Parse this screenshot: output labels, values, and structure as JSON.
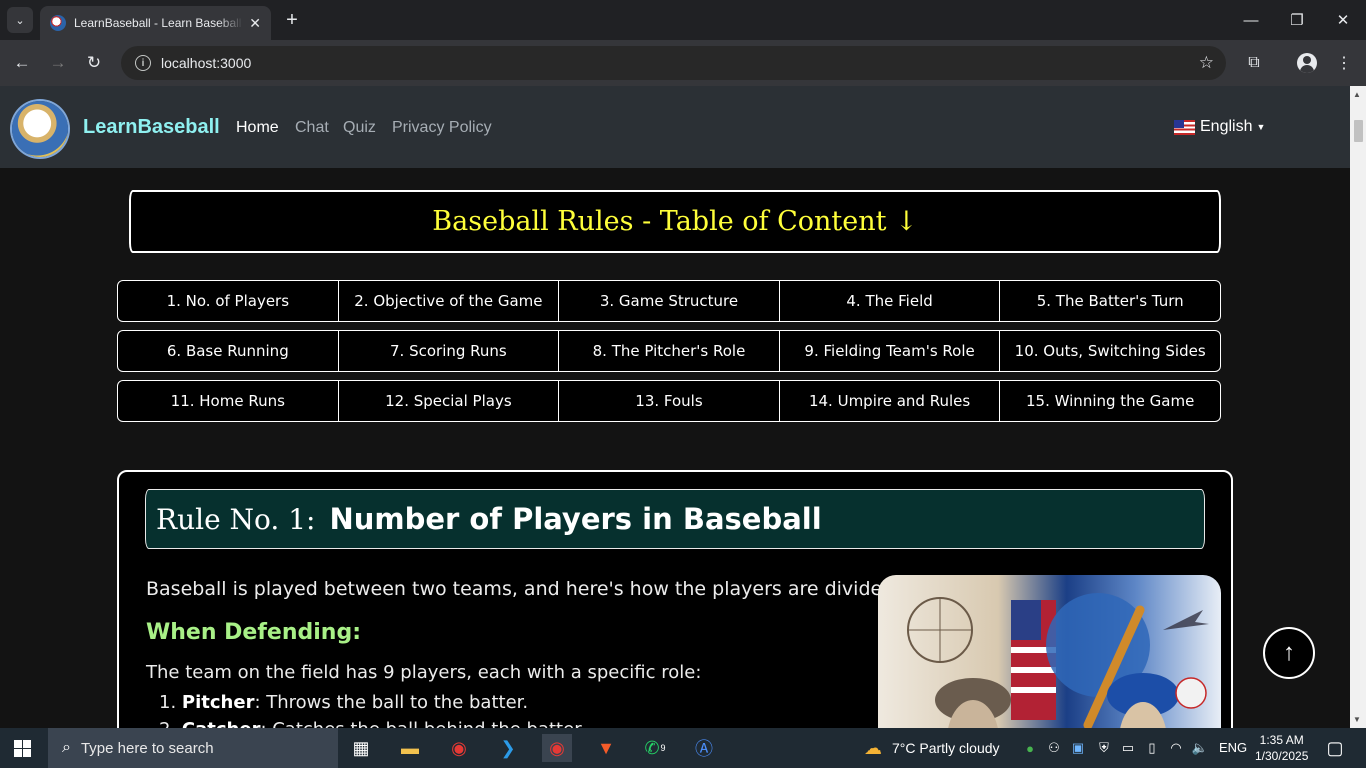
{
  "browser": {
    "tab_title": "LearnBaseball - Learn Baseball Rules",
    "url": "localhost:3000"
  },
  "nav": {
    "brand": "LearnBaseball",
    "links": [
      "Home",
      "Chat",
      "Quiz",
      "Privacy Policy"
    ],
    "language": "English"
  },
  "toc": {
    "title": "Baseball Rules - Table of Content ↓",
    "rows": [
      [
        "1. No. of Players",
        "2. Objective of the Game",
        "3. Game Structure",
        "4. The Field",
        "5. The Batter's Turn"
      ],
      [
        "6. Base Running",
        "7. Scoring Runs",
        "8. The Pitcher's Role",
        "9. Fielding Team's Role",
        "10. Outs, Switching Sides"
      ],
      [
        "11. Home Runs",
        "12. Special Plays",
        "13. Fouls",
        "14. Umpire and Rules",
        "15. Winning the Game"
      ]
    ]
  },
  "rule": {
    "number_label": "Rule No. 1:",
    "title": "Number of Players in Baseball",
    "intro": "Baseball is played between two teams, and here's how the players are divided:",
    "subheading": "When Defending:",
    "team_text": "The team on the field has 9 players, each with a specific role:",
    "roles": [
      {
        "n": "1.",
        "name": "Pitcher",
        "desc": ": Throws the ball to the batter."
      },
      {
        "n": "2.",
        "name": "Catcher",
        "desc": ": Catches the ball behind the batter."
      }
    ]
  },
  "taskbar": {
    "search_placeholder": "Type here to search",
    "weather": "7°C  Partly cloudy",
    "lang": "ENG",
    "time": "1:35 AM",
    "date": "1/30/2025",
    "whatsapp_badge": "9"
  }
}
